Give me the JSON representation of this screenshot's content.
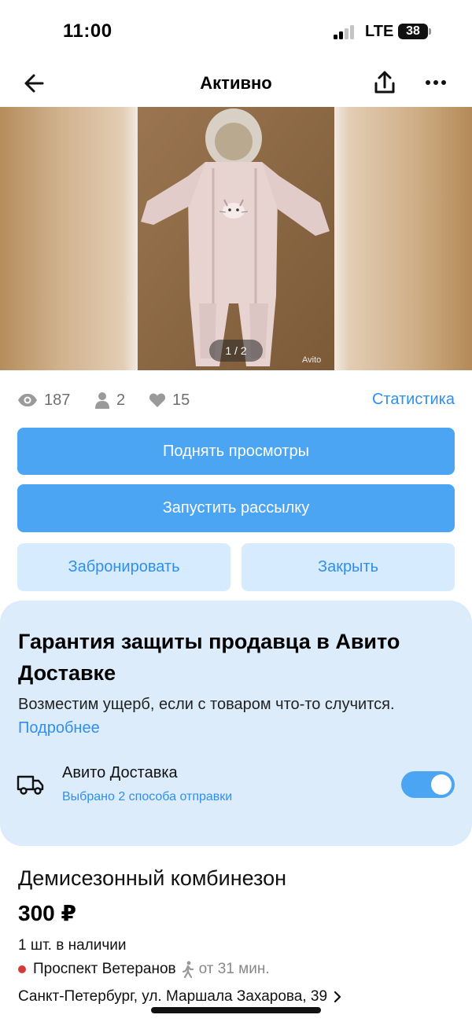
{
  "status_bar": {
    "time": "11:00",
    "network": "LTE",
    "battery": "38"
  },
  "nav": {
    "title": "Активно",
    "back_icon": "arrow-left-icon",
    "share_icon": "share-icon",
    "more_icon": "more-dots-icon"
  },
  "gallery": {
    "counter": "1 / 2",
    "watermark": "Avito"
  },
  "stats": {
    "views": "187",
    "contacts": "2",
    "favorites": "15",
    "link": "Статистика"
  },
  "actions": {
    "raise_views": "Поднять просмотры",
    "start_mailing": "Запустить рассылку",
    "reserve": "Забронировать",
    "close": "Закрыть"
  },
  "guarantee": {
    "title": "Гарантия защиты продавца в Авито Доставке",
    "text": "Возместим ущерб, если с товаром что-то случится.",
    "link": "Подробнее",
    "delivery_title": "Авито Доставка",
    "delivery_subtitle": "Выбрано 2 способа отправки",
    "delivery_enabled": true
  },
  "item": {
    "title": "Демисезонный комбинезон",
    "price": "300 ₽",
    "stock": "1 шт. в наличии",
    "metro": "Проспект Ветеранов",
    "metro_time": "от 31 мин.",
    "address": "Санкт-Петербург, ул. Маршала Захарова, 39"
  },
  "colors": {
    "accent": "#4ba5f3",
    "link": "#2f8ff0",
    "secondary_button_bg": "#d6ebfd",
    "panel_bg": "#dcecfb",
    "metro_line": "#d53a3a"
  }
}
